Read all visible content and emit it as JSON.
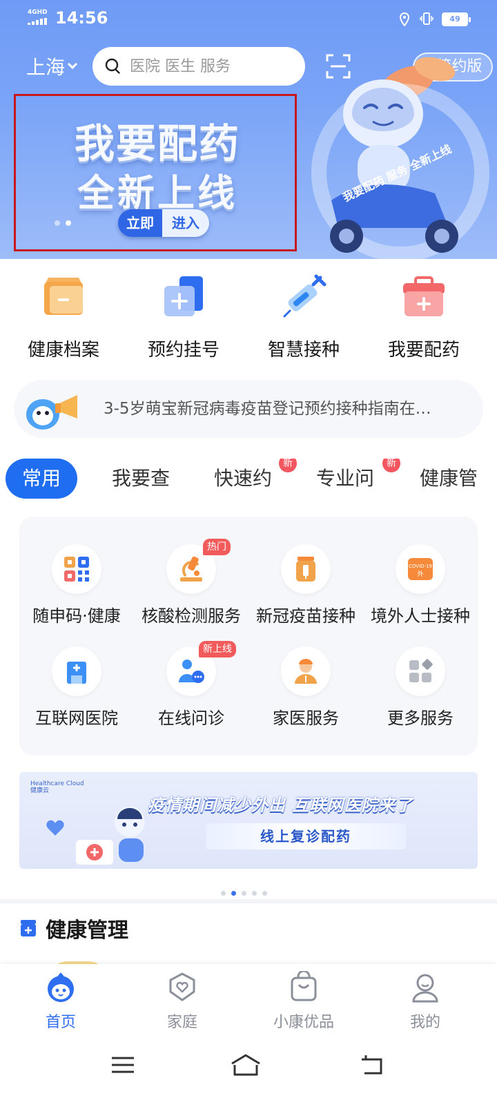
{
  "status_bar": {
    "network": "4GHD",
    "time": "14:56",
    "battery": "49"
  },
  "header": {
    "city": "上海",
    "search_placeholder": "医院 医生 服务",
    "simple_mode_label": "⇋简约版"
  },
  "banner": {
    "title": "我要配药",
    "subtitle": "全新上线",
    "cta_left": "立即",
    "cta_right": "进入",
    "mascot_ring_text": "我要配药 服务 全新上线"
  },
  "quick_entries": [
    {
      "label": "健康档案",
      "icon": "folder-icon"
    },
    {
      "label": "预约挂号",
      "icon": "appointment-icon"
    },
    {
      "label": "智慧接种",
      "icon": "syringe-icon"
    },
    {
      "label": "我要配药",
      "icon": "medicine-kit-icon"
    }
  ],
  "notice": {
    "text": "3-5岁萌宝新冠病毒疫苗登记预约接种指南在…"
  },
  "tabs": [
    {
      "label": "常用",
      "active": true
    },
    {
      "label": "我要查"
    },
    {
      "label": "快速约",
      "badge": "新"
    },
    {
      "label": "专业问",
      "badge": "新"
    },
    {
      "label": "健康管"
    }
  ],
  "services": [
    {
      "label": "随申码·健康",
      "icon": "qr-code-icon"
    },
    {
      "label": "核酸检测服务",
      "icon": "microscope-icon",
      "badge": "热门"
    },
    {
      "label": "新冠疫苗接种",
      "icon": "vaccine-bottle-icon"
    },
    {
      "label": "境外人士接种",
      "icon": "covid-vaccine-icon",
      "icon_text": "COVID-19",
      "icon_sub": "外"
    },
    {
      "label": "互联网医院",
      "icon": "hospital-icon"
    },
    {
      "label": "在线问诊",
      "icon": "doctor-chat-icon",
      "badge": "新上线"
    },
    {
      "label": "家医服务",
      "icon": "family-doctor-icon"
    },
    {
      "label": "更多服务",
      "icon": "more-grid-icon"
    }
  ],
  "promo": {
    "logo_text": "Healthcare Cloud",
    "logo_cn": "健康云",
    "title": "疫情期间减少外出 互联网医院来了",
    "pill": "线上复诊配药"
  },
  "health_mgmt": {
    "title": "健康管理"
  },
  "bottom_nav": [
    {
      "label": "首页",
      "icon": "home-mascot-icon",
      "active": true
    },
    {
      "label": "家庭",
      "icon": "family-heart-icon"
    },
    {
      "label": "小康优品",
      "icon": "shopping-bag-icon"
    },
    {
      "label": "我的",
      "icon": "profile-icon"
    }
  ],
  "colors": {
    "primary": "#1f6df0",
    "hero_bg": "#7aa4f7",
    "badge_red": "#f2575f",
    "banner_outline": "#c8161d"
  }
}
